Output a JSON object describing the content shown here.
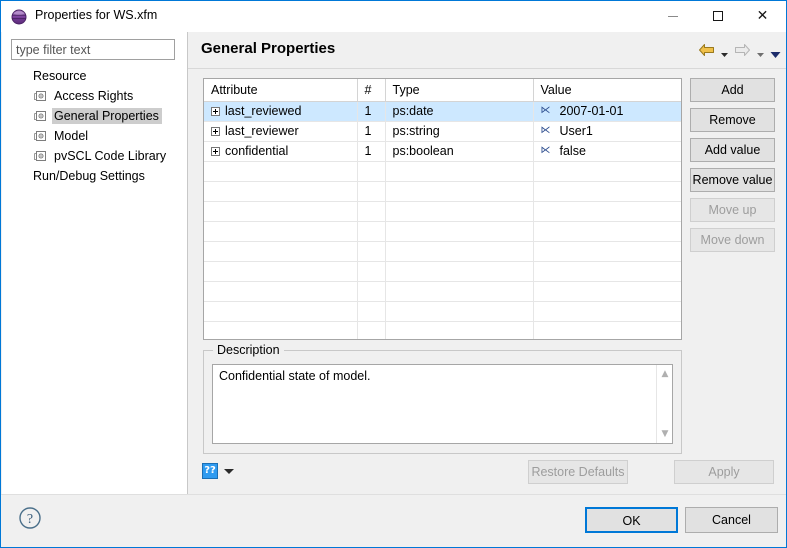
{
  "window": {
    "title": "Properties for WS.xfm",
    "icon": "sphere-icon",
    "controls": {
      "minimize": "minimize-icon",
      "maximize": "maximize-icon",
      "close": "close-icon"
    }
  },
  "sidebar": {
    "filter": {
      "placeholder": "type filter text",
      "value": ""
    },
    "items": [
      {
        "label": "Resource",
        "icon": null,
        "selected": false
      },
      {
        "label": "Access Rights",
        "icon": "property-page-icon",
        "selected": false
      },
      {
        "label": "General Properties",
        "icon": "property-page-icon",
        "selected": true
      },
      {
        "label": "Model",
        "icon": "property-page-icon",
        "selected": false
      },
      {
        "label": "pvSCL Code Library",
        "icon": "property-page-icon",
        "selected": false
      },
      {
        "label": "Run/Debug Settings",
        "icon": null,
        "selected": false
      }
    ]
  },
  "content": {
    "title": "General Properties",
    "nav": {
      "back": "back-arrow-icon",
      "back_menu": "back-dropdown-icon",
      "forward": "forward-arrow-icon",
      "forward_menu": "forward-dropdown-icon",
      "view_menu": "view-menu-icon"
    },
    "table": {
      "columns": [
        "Attribute",
        "#",
        "Type",
        "Value"
      ],
      "rows": [
        {
          "attribute": "last_reviewed",
          "count": "1",
          "type": "ps:date",
          "value": "2007-01-01",
          "selected": true
        },
        {
          "attribute": "last_reviewer",
          "count": "1",
          "type": "ps:string",
          "value": "User1",
          "selected": false
        },
        {
          "attribute": "confidential",
          "count": "1",
          "type": "ps:boolean",
          "value": "false",
          "selected": false
        }
      ],
      "empty_row_count": 10,
      "value_icon": "value-link-icon",
      "expander_icon": "expand-plus-icon",
      "selection_color": "#cde8ff"
    },
    "side_buttons": [
      {
        "label": "Add",
        "enabled": true
      },
      {
        "label": "Remove",
        "enabled": true
      },
      {
        "label": "Add value",
        "enabled": true
      },
      {
        "label": "Remove value",
        "enabled": true
      },
      {
        "label": "Move up",
        "enabled": false
      },
      {
        "label": "Move down",
        "enabled": false
      }
    ],
    "description": {
      "legend": "Description",
      "text": "Confidential state of model.",
      "scroll_up": "scroll-up-arrow",
      "scroll_down": "scroll-down-arrow"
    },
    "sub_footer": {
      "help_badge": "??",
      "help_caret": "dropdown-caret-icon",
      "restore_defaults": {
        "label": "Restore Defaults",
        "enabled": false
      },
      "apply": {
        "label": "Apply",
        "enabled": false
      }
    }
  },
  "footer": {
    "help": "help-question-icon",
    "ok": {
      "label": "OK",
      "default": true
    },
    "cancel": {
      "label": "Cancel",
      "default": false
    }
  }
}
